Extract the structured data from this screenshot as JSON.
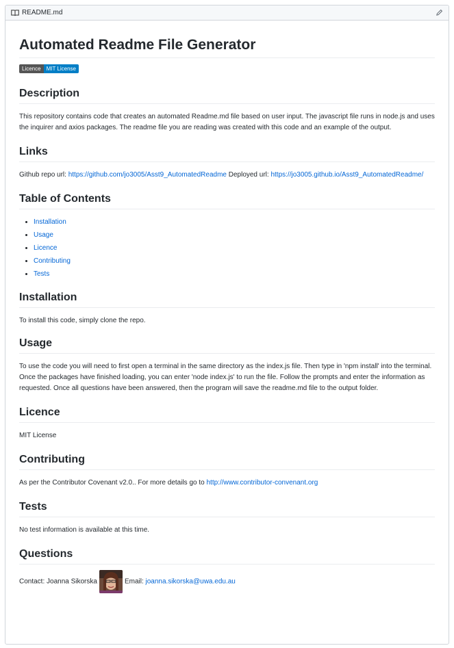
{
  "header": {
    "filename": "README.md"
  },
  "title": "Automated Readme File Generator",
  "badge": {
    "label": "Licence",
    "value": "MIT License"
  },
  "sections": {
    "description": {
      "heading": "Description",
      "text": "This repository contains code that creates an automated Readme.md file based on user input. The javascript file runs in node.js and uses the inquirer and axios packages. The readme file you are reading was created with this code and an example of the output."
    },
    "links": {
      "heading": "Links",
      "repo_prefix": "Github repo url: ",
      "repo_url": "https://github.com/jo3005/Asst9_AutomatedReadme",
      "deployed_prefix": " Deployed url: ",
      "deployed_url": "https://jo3005.github.io/Asst9_AutomatedReadme/"
    },
    "toc": {
      "heading": "Table of Contents",
      "items": [
        "Installation",
        "Usage",
        "Licence",
        "Contributing",
        "Tests"
      ]
    },
    "installation": {
      "heading": "Installation",
      "text": "To install this code, simply clone the repo."
    },
    "usage": {
      "heading": "Usage",
      "text": "To use the code you will need to first open a terminal in the same directory as the index.js file. Then type in 'npm install' into the terminal. Once the packages have finished loading, you can enter 'node index.js' to run the file. Follow the prompts and enter the information as requested. Once all questions have been answered, then the program will save the readme.md file to the output folder."
    },
    "licence": {
      "heading": "Licence",
      "text": "MIT License"
    },
    "contributing": {
      "heading": "Contributing",
      "text": "As per the Contributor Covenant v2.0.. For more details go to ",
      "link": "http://www.contributor-convenant.org"
    },
    "tests": {
      "heading": "Tests",
      "text": "No test information is available at this time."
    },
    "questions": {
      "heading": "Questions",
      "contact_prefix": "Contact: Joanna Sikorska",
      "email_prefix": "Email: ",
      "email": "joanna.sikorska@uwa.edu.au"
    }
  },
  "colors": {
    "link": "#0366d6",
    "badge_left": "#555555",
    "badge_right": "#007ec6"
  }
}
